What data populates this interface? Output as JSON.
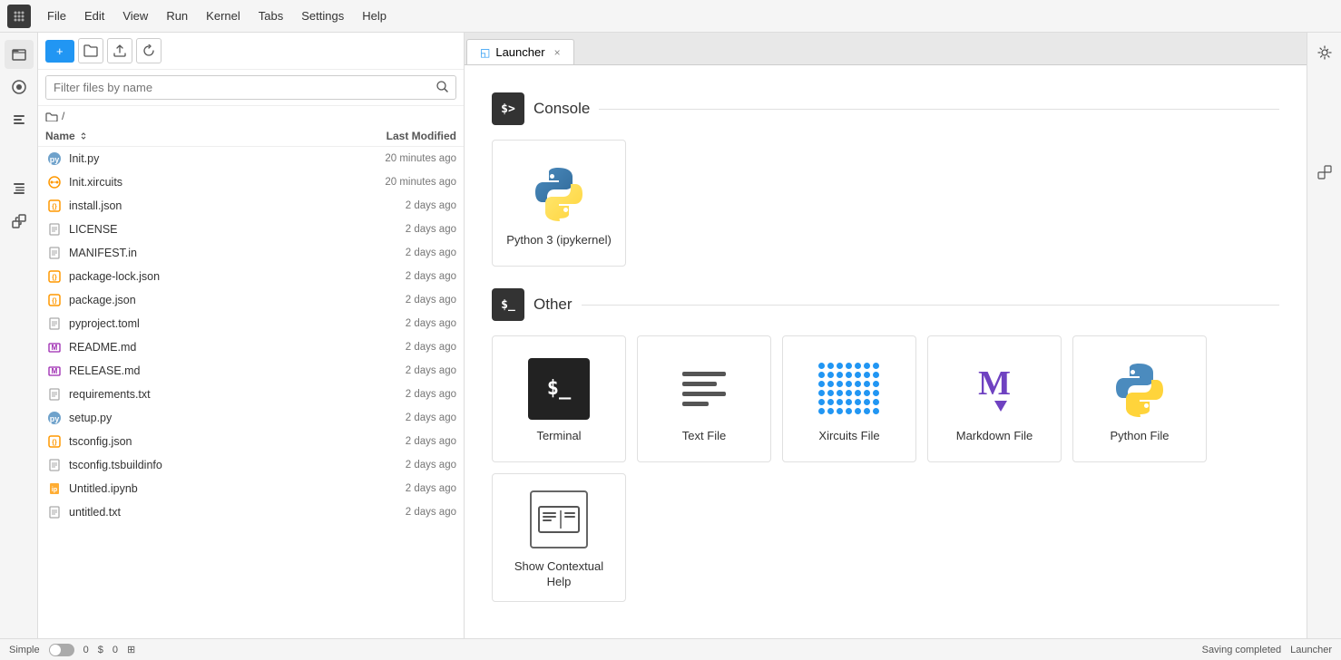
{
  "menubar": {
    "items": [
      "File",
      "Edit",
      "View",
      "Run",
      "Kernel",
      "Tabs",
      "Settings",
      "Help"
    ]
  },
  "toolbar": {
    "new_label": "+",
    "search_placeholder": "Filter files by name"
  },
  "breadcrumb": {
    "path": "/ /"
  },
  "file_list": {
    "columns": {
      "name": "Name",
      "modified": "Last Modified"
    },
    "files": [
      {
        "name": "Init.py",
        "modified": "20 minutes ago",
        "icon": "py"
      },
      {
        "name": "Init.xircuits",
        "modified": "20 minutes ago",
        "icon": "xrc"
      },
      {
        "name": "install.json",
        "modified": "2 days ago",
        "icon": "json"
      },
      {
        "name": "LICENSE",
        "modified": "2 days ago",
        "icon": "file"
      },
      {
        "name": "MANIFEST.in",
        "modified": "2 days ago",
        "icon": "file"
      },
      {
        "name": "package-lock.json",
        "modified": "2 days ago",
        "icon": "json"
      },
      {
        "name": "package.json",
        "modified": "2 days ago",
        "icon": "json"
      },
      {
        "name": "pyproject.toml",
        "modified": "2 days ago",
        "icon": "file"
      },
      {
        "name": "README.md",
        "modified": "2 days ago",
        "icon": "md"
      },
      {
        "name": "RELEASE.md",
        "modified": "2 days ago",
        "icon": "md"
      },
      {
        "name": "requirements.txt",
        "modified": "2 days ago",
        "icon": "file"
      },
      {
        "name": "setup.py",
        "modified": "2 days ago",
        "icon": "py"
      },
      {
        "name": "tsconfig.json",
        "modified": "2 days ago",
        "icon": "json"
      },
      {
        "name": "tsconfig.tsbuildinfo",
        "modified": "2 days ago",
        "icon": "file"
      },
      {
        "name": "Untitled.ipynb",
        "modified": "2 days ago",
        "icon": "nb"
      },
      {
        "name": "untitled.txt",
        "modified": "2 days ago",
        "icon": "file"
      }
    ]
  },
  "tabs": [
    {
      "label": "Launcher",
      "icon": "◱"
    }
  ],
  "launcher": {
    "sections": [
      {
        "title": "Console",
        "icon": ">_",
        "cards": [
          {
            "label": "Python 3\n(ipykernel)",
            "icon": "python"
          }
        ]
      },
      {
        "title": "Other",
        "icon": "$_",
        "cards": [
          {
            "label": "Terminal",
            "icon": "terminal"
          },
          {
            "label": "Text File",
            "icon": "textfile"
          },
          {
            "label": "Xircuits File",
            "icon": "xircuits"
          },
          {
            "label": "Markdown File",
            "icon": "markdown"
          },
          {
            "label": "Python File",
            "icon": "pythonfile"
          },
          {
            "label": "Show Contextual\nHelp",
            "icon": "help"
          }
        ]
      }
    ]
  },
  "status": {
    "mode": "Simple",
    "items": [
      "0",
      "0"
    ]
  }
}
